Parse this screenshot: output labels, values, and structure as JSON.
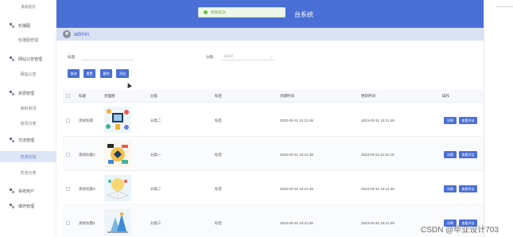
{
  "sidebar": {
    "home": "系统首页",
    "items": [
      {
        "type": "group",
        "label": "轮播图",
        "icon": "menu-grid-icon"
      },
      {
        "type": "child",
        "label": "轮播图管理"
      },
      {
        "type": "group",
        "label": "网站公告管理",
        "icon": "menu-grid-icon"
      },
      {
        "type": "child",
        "label": "网站公告"
      },
      {
        "type": "group",
        "label": "资源管理",
        "icon": "menu-grid-icon"
      },
      {
        "type": "child",
        "label": "资料资讯"
      },
      {
        "type": "child",
        "label": "资讯分类"
      },
      {
        "type": "group",
        "label": "交流管理",
        "icon": "menu-grid-icon"
      },
      {
        "type": "child",
        "label": "交流论坛",
        "active": true
      },
      {
        "type": "child",
        "label": "交流分类"
      },
      {
        "type": "group",
        "label": "系统用户",
        "icon": "menu-grid-icon"
      },
      {
        "type": "group",
        "label": "爆炸管理",
        "icon": "menu-grid-icon"
      }
    ]
  },
  "header": {
    "title": "台系统",
    "toast": "修改成功!",
    "user": "admin"
  },
  "search": {
    "title_label": "标题:",
    "category_label": "分类:",
    "category_placeholder": "请选择"
  },
  "toolbar": {
    "query": "查询",
    "reset": "重置",
    "delete": "删除",
    "add": "添加"
  },
  "table": {
    "columns": [
      "标题",
      "封面图",
      "分类",
      "标签",
      "创建时间",
      "更新时间",
      "操作"
    ],
    "rows": [
      {
        "title": "测试标题",
        "category": "分类二",
        "tag": "标签",
        "created": "2023-03-31 10:21:49",
        "updated": "2023-03-31 10:21:49"
      },
      {
        "title": "测试标题2",
        "category": "分类一",
        "tag": "标签",
        "created": "2023-03-31 10:21:49",
        "updated": "2023-03-24 11:31:19"
      },
      {
        "title": "测试标题3",
        "category": "分类二",
        "tag": "标签",
        "created": "2023-03-31 10:21:49",
        "updated": "2023-03-31 10:21:49"
      },
      {
        "title": "测试标题4",
        "category": "分类三",
        "tag": "标签",
        "created": "2023-03-31 10:21:49",
        "updated": "2023-03-31 10:21:49"
      }
    ],
    "detail_label": "详情",
    "comment_label": "查看评论"
  },
  "watermark": "CSDN @毕业设计703",
  "colors": {
    "primary": "#4a6fd6",
    "subbar": "#d9e1f4",
    "active_bg": "#dde6f6",
    "toast_green": "#67c23a"
  }
}
